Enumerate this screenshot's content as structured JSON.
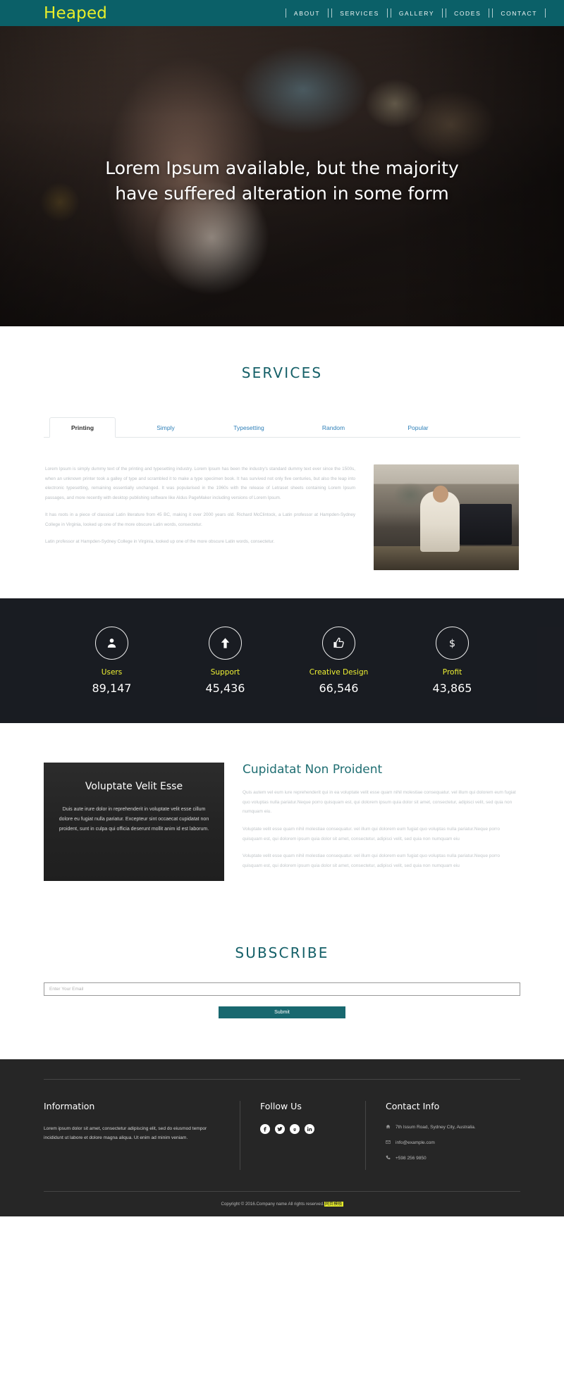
{
  "header": {
    "logo": "Heaped",
    "nav": [
      {
        "label": "ABOUT"
      },
      {
        "label": "SERVICES"
      },
      {
        "label": "GALLERY"
      },
      {
        "label": "CODES"
      },
      {
        "label": "CONTACT"
      }
    ]
  },
  "hero": {
    "title_line1": "Lorem Ipsum available, but the majority",
    "title_line2": "have suffered alteration in some form"
  },
  "services": {
    "title": "SERVICES",
    "tabs": [
      {
        "label": "Printing",
        "active": true
      },
      {
        "label": "Simply",
        "active": false
      },
      {
        "label": "Typesetting",
        "active": false
      },
      {
        "label": "Random",
        "active": false
      },
      {
        "label": "Popular",
        "active": false
      }
    ],
    "paragraphs": [
      "Lorem Ipsum is simply dummy text of the printing and typesetting industry. Lorem Ipsum has been the industry's standard dummy text ever since the 1500s, when an unknown printer took a galley of type and scrambled it to make a type specimen book. It has survived not only five centuries, but also the leap into electronic typesetting, remaining essentially unchanged. It was popularised in the 1960s with the release of Letraset sheets containing Lorem Ipsum passages, and more recently with desktop publishing software like Aldus PageMaker including versions of Lorem Ipsum.",
      "It has roots in a piece of classical Latin literature from 45 BC, making it over 2000 years old. Richard McClintock, a Latin professor at Hampden-Sydney College in Virginia, looked up one of the more obscure Latin words, consectetur.",
      "Latin professor at Hampden-Sydney College in Virginia, looked up one of the more obscure Latin words, consectetur."
    ],
    "image_alt": "office-worker-photo"
  },
  "stats": [
    {
      "icon": "user-icon",
      "label": "Users",
      "value": "89,147"
    },
    {
      "icon": "arrow-up-icon",
      "label": "Support",
      "value": "45,436"
    },
    {
      "icon": "thumbs-up-icon",
      "label": "Creative Design",
      "value": "66,546"
    },
    {
      "icon": "dollar-icon",
      "label": "Profit",
      "value": "43,865"
    }
  ],
  "about": {
    "card": {
      "title": "Voluptate Velit Esse",
      "text": "Duis aute irure dolor in reprehenderit in voluptate velit esse cillum dolore eu fugiat nulla pariatur. Excepteur sint occaecat cupidatat non proident, sunt in culpa qui officia deserunt mollit anim id est laborum."
    },
    "heading": "Cupidatat Non Proident",
    "paragraphs": [
      "Quis autem vel eum iure reprehenderit qui in ea voluptate velit esse quam nihil molestiae consequatur. vel illum qui dolorem eum fugiat quo voluptas nulla pariatur.Neque porro quisquam est, qui dolorem ipsum quia dolor sit amet, consectetur, adipisci velit, sed quia non numquam eiu.",
      "Voluptate velit esse quam nihil molestiae consequatur. vel illum qui dolorem eum fugiat quo voluptas nulla pariatur.Neque porro quisquam est, qui dolorem ipsum quia dolor sit amet, consectetur, adipisci velit, sed quia non numquam eiu",
      "Voluptate velit esse quam nihil molestiae consequatur. vel illum qui dolorem eum fugiat quo voluptas nulla pariatur.Neque porro quisquam est, qui dolorem ipsum quia dolor sit amet, consectetur, adipisci velit, sed quia non numquam eiu"
    ]
  },
  "subscribe": {
    "title": "SUBSCRIBE",
    "placeholder": "Enter Your Email",
    "value": "",
    "submit_label": "Submit"
  },
  "footer": {
    "information": {
      "title": "Information",
      "text": "Lorem ipsum dolor sit amet, consectetur adipiscing elit, sed do eiusmod tempor incididunt ut labore et dolore magna aliqua. Ut enim ad minim veniam."
    },
    "follow": {
      "title": "Follow Us",
      "socials": [
        {
          "name": "facebook-icon",
          "glyph": "f"
        },
        {
          "name": "twitter-icon",
          "glyph": "t"
        },
        {
          "name": "google-plus-icon",
          "glyph": "g"
        },
        {
          "name": "linkedin-icon",
          "glyph": "in"
        }
      ]
    },
    "contact": {
      "title": "Contact Info",
      "items": [
        {
          "icon": "home-icon",
          "text": "7th Issum Road, Sydney City, Australia."
        },
        {
          "icon": "mail-icon",
          "text": "info@example.com"
        },
        {
          "icon": "phone-icon",
          "text": "+598 256 9850"
        }
      ]
    },
    "copyright_prefix": "Copyright © 2016.Company name All rights reserved.",
    "copyright_link": "网页模板"
  },
  "colors": {
    "brand_teal": "#0b6068",
    "logo_yellow": "#e8ef2a",
    "heading_teal": "#156068",
    "footer_dark": "#262626",
    "tab_link_blue": "#2d7fb8"
  }
}
